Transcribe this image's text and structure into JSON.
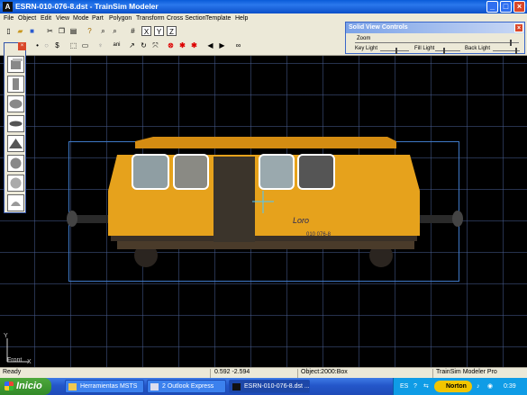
{
  "window": {
    "title": "ESRN-010-076-8.dst - TrainSim Modeler",
    "app_icon": "A"
  },
  "menu": [
    "File",
    "Object",
    "Edit",
    "View",
    "Mode",
    "Part",
    "Polygon",
    "Transform",
    "Cross Section",
    "Template",
    "Help"
  ],
  "toolbar": {
    "row1": [
      "new-icon",
      "open-icon",
      "save-icon",
      "cut-icon",
      "copy-icon",
      "paste-icon",
      "help-icon",
      "zoom-in-icon",
      "zoom-out-icon",
      "grid-icon",
      "x-axis-icon",
      "y-axis-icon",
      "z-axis-icon"
    ],
    "row2": [
      "select-icon",
      "select-vertex-icon",
      "select-point-icon",
      "text-icon",
      "box-icon",
      "rect-icon",
      "tree-icon",
      "text-tool-icon",
      "arrow-icon",
      "rotate-icon",
      "scale-icon",
      "light-icon",
      "paint1-icon",
      "paint2-icon",
      "prev-icon",
      "next-icon",
      "binoculars-icon"
    ],
    "labels": {
      "x": "X",
      "y": "Y",
      "z": "Z",
      "ani": "ani"
    }
  },
  "solid_view": {
    "title": "Solid View Controls",
    "zoom": "Zoom",
    "key_light": "Key Light",
    "fill_light": "Fill Light",
    "back_light": "Back Light",
    "levels": {
      "zoom": 0.95,
      "key": 0.55,
      "fill": 0.35,
      "back": 0.85
    }
  },
  "palette": {
    "items": [
      "cube-icon",
      "cylinder-icon",
      "ellipse-icon",
      "disc-icon",
      "prism-icon",
      "sphere-icon",
      "hemisphere-icon",
      "cone-icon"
    ]
  },
  "viewport": {
    "view_name": "Front",
    "axis_x": "X",
    "axis_y": "Y",
    "vehicle_markings": [
      "Loro",
      "010 076-8"
    ],
    "colors": {
      "background": "#000000",
      "grid": "#465a8c",
      "bbox": "#3f79c7",
      "body": "#e6a21c"
    }
  },
  "status": {
    "left": "Ready",
    "coords": "0.592  -2.594",
    "object": "Object:2000:Box",
    "product": "TrainSim Modeler Pro"
  },
  "taskbar": {
    "start": "Inicio",
    "tasks": [
      "Herramientas MSTS",
      "2 Outlook Express",
      "ESRN-010-076-8.dst ..."
    ],
    "tray": {
      "lang": "ES",
      "norton": "Norton",
      "time": "0:39"
    }
  }
}
